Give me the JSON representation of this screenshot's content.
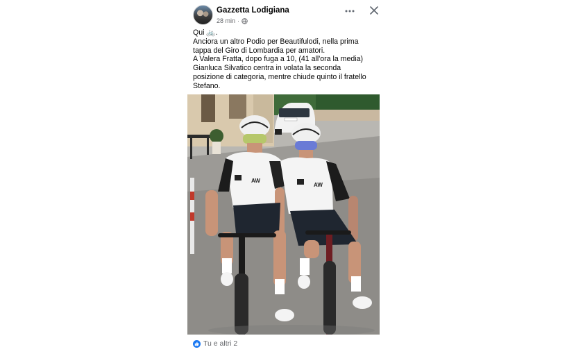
{
  "post": {
    "page_name": "Gazzetta Lodigiana",
    "timestamp": "28 min",
    "meta_separator": "·",
    "privacy_icon": "globe-icon",
    "more_icon": "more-horizontal-icon",
    "close_icon": "close-icon",
    "caption_lines": [
      "Qui 🚲.",
      "Anciora un altro Podio per Beautifulodi, nella prima",
      "tappa del Giro di Lombardia per amatori.",
      "A Valera Fratta, dopo fuga a 10, (41 all'ora la media)",
      "Gianluca Silvatico centra in volata la seconda",
      "posizione di categoria, mentre chiude quinto il fratello",
      "Stefano."
    ],
    "photo": {
      "subject": "two cyclists in white jerseys with road bikes",
      "jersey_text": "AW"
    },
    "reactions": {
      "icon": "like-icon",
      "text": "Tu e altri 2"
    }
  }
}
